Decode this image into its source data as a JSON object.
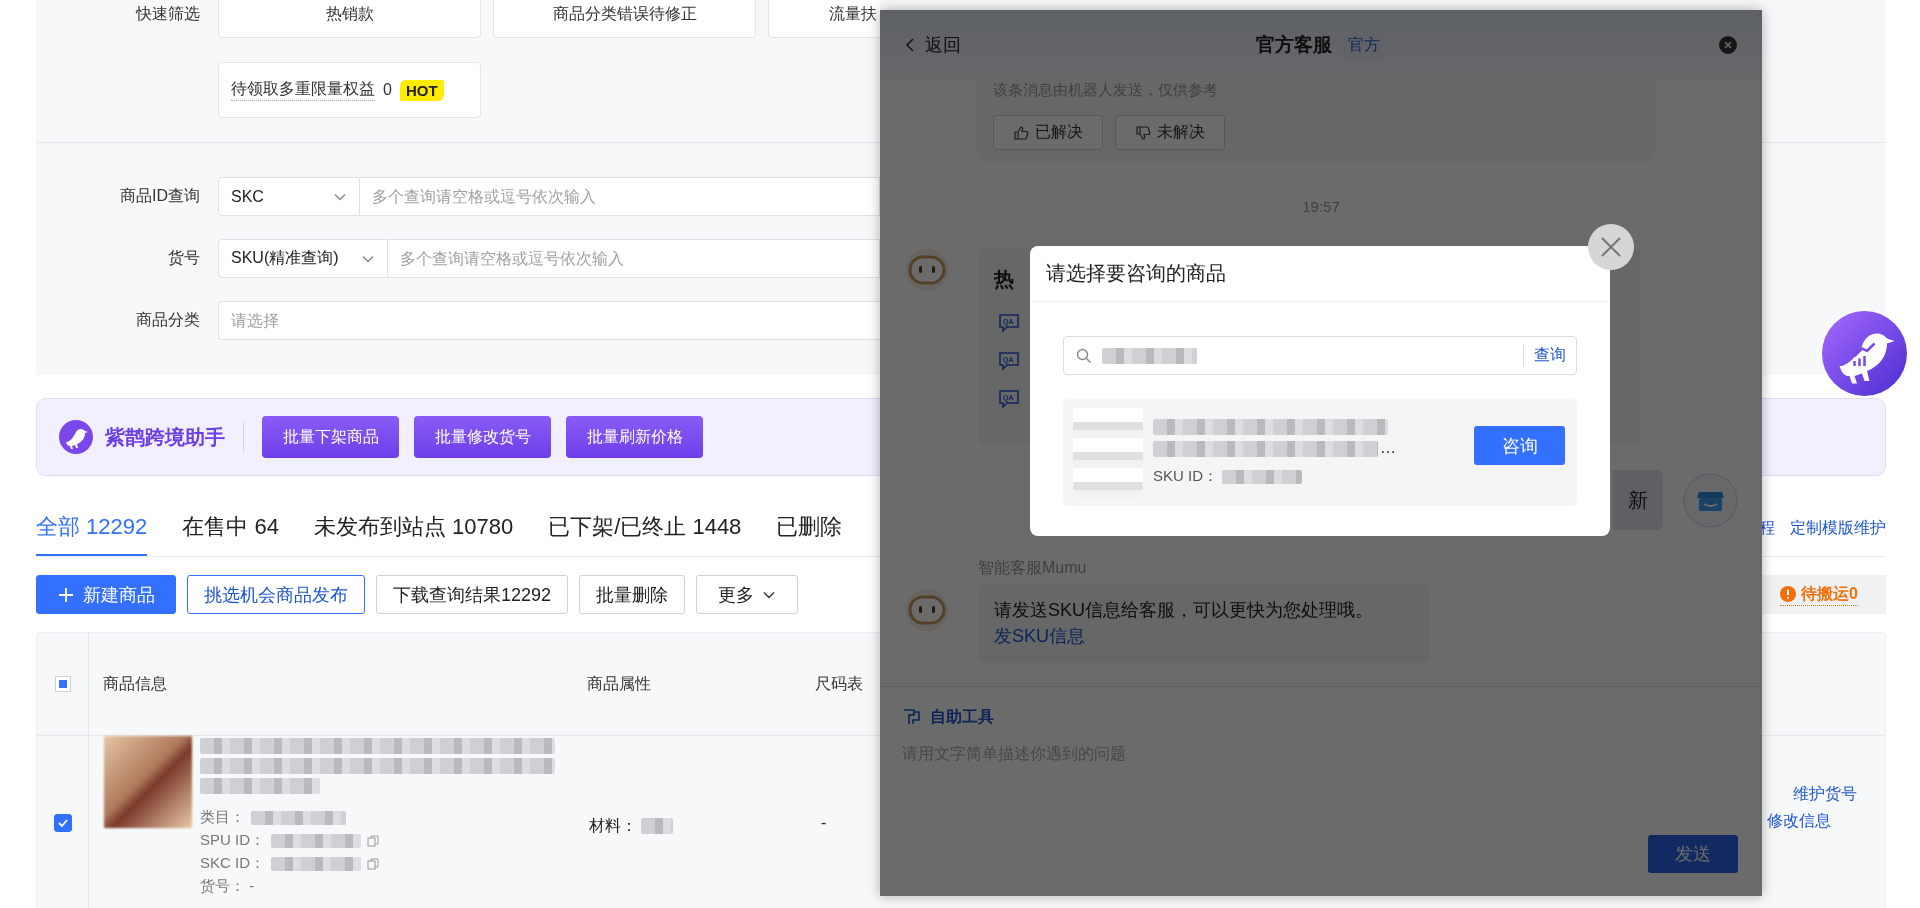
{
  "quick_filter": {
    "label": "快速筛选",
    "chips": [
      "热销款",
      "商品分类错误待修正",
      "流量扶"
    ],
    "benefit_chip": {
      "label": "待领取多重限量权益",
      "count": "0",
      "badge": "HOT"
    }
  },
  "search_form": {
    "fields": [
      {
        "kind": "select-input",
        "label": "商品ID查询",
        "select": "SKC",
        "placeholder": "多个查询请空格或逗号依次输入"
      },
      {
        "kind": "select-input",
        "label": "货号",
        "select": "SKU(精准查询)",
        "placeholder": "多个查询请空格或逗号依次输入"
      },
      {
        "kind": "select",
        "label": "商品分类",
        "placeholder": "请选择"
      }
    ]
  },
  "assistant_banner": {
    "name": "紫鹊跨境助手",
    "buttons": [
      "批量下架商品",
      "批量修改货号",
      "批量刷新价格"
    ]
  },
  "tabs": [
    {
      "label": "全部 12292",
      "selected": true
    },
    {
      "label": "在售中 64",
      "selected": false
    },
    {
      "label": "未发布到站点 10780",
      "selected": false
    },
    {
      "label": "已下架/已终止 1448",
      "selected": false
    },
    {
      "label": "已删除",
      "selected": false
    }
  ],
  "tab_links": [
    "程",
    "定制模版维护"
  ],
  "toolbar": {
    "buttons": [
      {
        "label": "新建商品",
        "kind": "primary"
      },
      {
        "label": "挑选机会商品发布",
        "kind": "outline"
      },
      {
        "label": "下载查询结果12292",
        "kind": "default"
      },
      {
        "label": "批量删除",
        "kind": "default"
      },
      {
        "label": "更多",
        "kind": "dropdown"
      }
    ],
    "pending": "待搬运0"
  },
  "table": {
    "select_all": {
      "indeterminate": true
    },
    "columns": [
      "商品信息",
      "商品属性",
      "尺码表"
    ],
    "rows": [
      {
        "checked": true,
        "meta": [
          {
            "label": "类目：",
            "redacted": true,
            "copy": false
          },
          {
            "label": "SPU ID：",
            "redacted": true,
            "copy": true
          },
          {
            "label": "SKC ID：",
            "redacted": true,
            "copy": true
          },
          {
            "label": "货号： -",
            "redacted": false,
            "copy": false
          }
        ],
        "attribute_label": "材料：",
        "size_chart": "-",
        "actions": [
          "维护货号",
          "修改信息"
        ]
      }
    ]
  },
  "chat": {
    "back": "返回",
    "title": "官方客服",
    "tag": "官方",
    "notice": "该条消息由机器人发送，仅供参考",
    "feedback": [
      {
        "label": "已解决",
        "kind": "up"
      },
      {
        "label": "未解决",
        "kind": "down"
      }
    ],
    "time": "19:57",
    "hot_heading": "热",
    "faq_icons": [
      "QA",
      "QA",
      "QA"
    ],
    "refresh": "新",
    "bot_name": "智能客服Mumu",
    "bot_message": "请发送SKU信息给客服，可以更快为您处理哦。",
    "bot_link": "发SKU信息",
    "tools": "自助工具",
    "input_placeholder": "请用文字简单描述你遇到的问题",
    "send": "发送"
  },
  "dialog": {
    "title": "请选择要咨询的商品",
    "search_button": "查询",
    "result": {
      "ellipsis": "…",
      "sku_label": "SKU ID：",
      "action": "咨询"
    }
  }
}
